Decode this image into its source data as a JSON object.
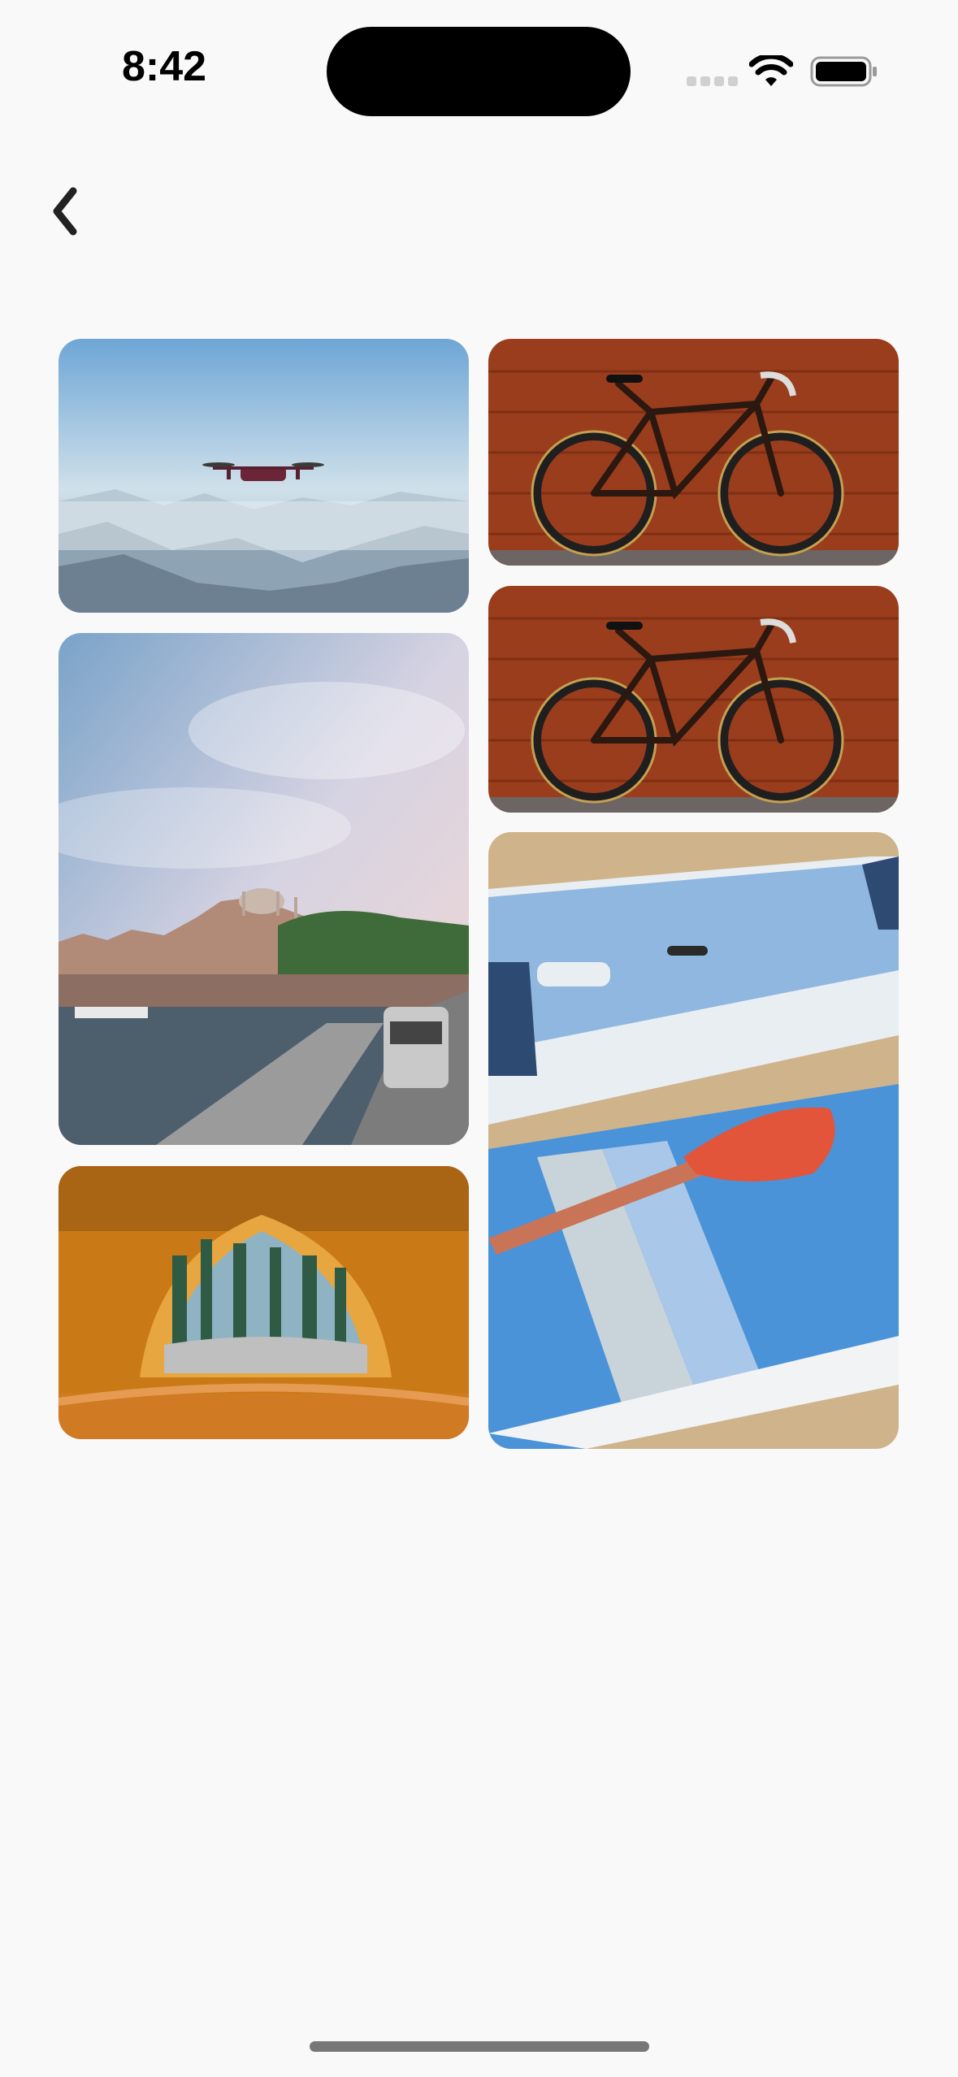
{
  "status_bar": {
    "time": "8:42",
    "wifi_icon": "wifi-icon",
    "battery_icon": "battery-icon"
  },
  "nav": {
    "back_icon": "chevron-left-icon"
  },
  "gallery": {
    "photos": [
      {
        "subject": "drone-over-misty-mountains",
        "colors": {
          "sky": "#6ea6d6",
          "mist": "#dfe9f0"
        }
      },
      {
        "subject": "road-bike-against-wooden-wall",
        "colors": {
          "wall": "#9a3d1c"
        }
      },
      {
        "subject": "road-bike-against-wooden-wall",
        "colors": {
          "wall": "#9a3d1c"
        }
      },
      {
        "subject": "istanbul-waterfront-with-tram",
        "colors": {
          "sky": "#b9c7dc",
          "water": "#4d5e6d"
        }
      },
      {
        "subject": "paddleboards-with-orange-paddle-on-sand",
        "colors": {
          "board": "#4a93d9",
          "paddle": "#e2553a",
          "sand": "#cfb38b"
        }
      },
      {
        "subject": "view-of-forest-from-inside-tent",
        "colors": {
          "tent": "#c97a17",
          "forest": "#2f5b45"
        }
      }
    ]
  }
}
